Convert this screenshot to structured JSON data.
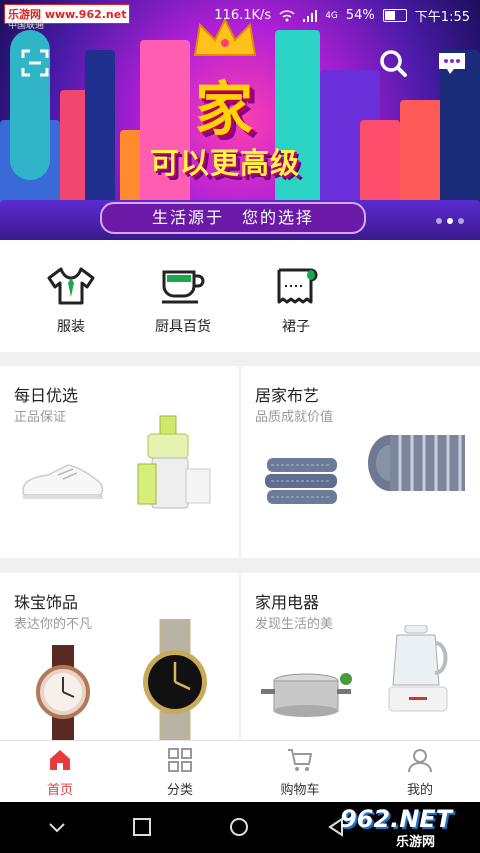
{
  "status_bar": {
    "source_tag": "乐游网 www.962.net",
    "carrier": "中国联通",
    "speed": "116.1K/s",
    "network": "4G",
    "battery": "54%",
    "battery_level": 0.54,
    "time": "下午1:55"
  },
  "banner": {
    "title": "家",
    "subtitle": "可以更高级",
    "slogan": "生活源于　您的选择"
  },
  "categories": [
    {
      "label": "服装",
      "icon": "shirt-icon"
    },
    {
      "label": "厨具百货",
      "icon": "cup-icon"
    },
    {
      "label": "裙子",
      "icon": "roll-icon"
    }
  ],
  "cards": [
    {
      "title": "每日优选",
      "subtitle": "正品保证"
    },
    {
      "title": "居家布艺",
      "subtitle": "品质成就价值"
    },
    {
      "title": "珠宝饰品",
      "subtitle": "表达你的不凡"
    },
    {
      "title": "家用电器",
      "subtitle": "发现生活的美"
    }
  ],
  "tabs": [
    {
      "label": "首页",
      "icon": "home-icon",
      "active": true
    },
    {
      "label": "分类",
      "icon": "grid-icon",
      "active": false
    },
    {
      "label": "购物车",
      "icon": "cart-icon",
      "active": false
    },
    {
      "label": "我的",
      "icon": "user-icon",
      "active": false
    }
  ],
  "watermark": {
    "text": "962.NET",
    "sub": "乐游网"
  },
  "colors": {
    "accent": "#e83c3c",
    "banner_purple": "#b11fd6",
    "banner_yellow": "#ffd400"
  }
}
